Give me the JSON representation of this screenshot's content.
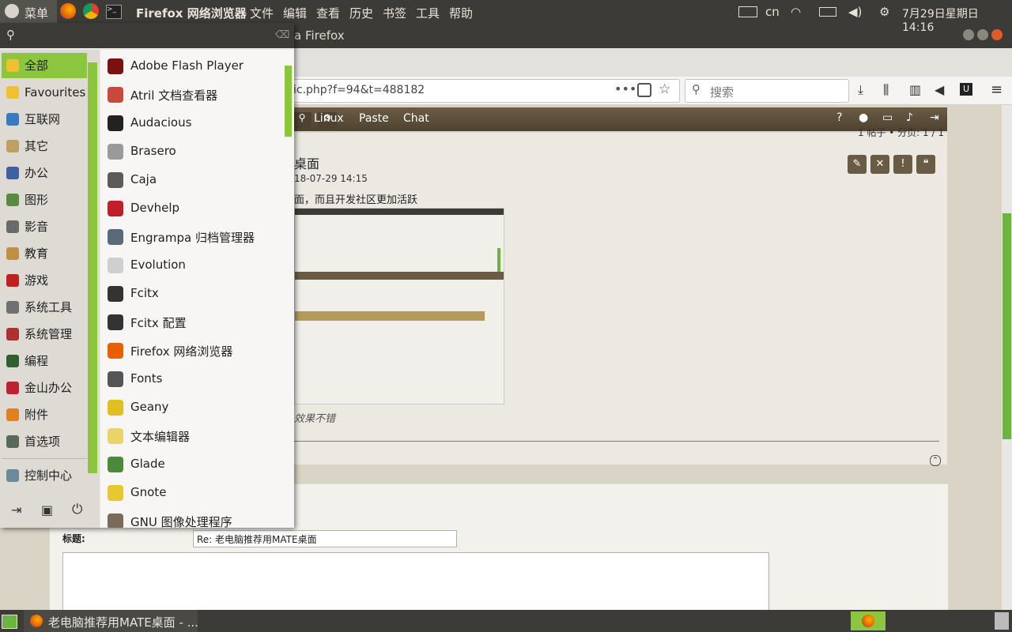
{
  "top_panel": {
    "menu_label": "菜单",
    "app_title": "Firefox 网络浏览器",
    "menus": [
      "文件",
      "编辑",
      "查看",
      "历史",
      "书签",
      "工具",
      "帮助"
    ],
    "ime": "cn",
    "datetime": "7月29日星期日 14:16"
  },
  "firefox": {
    "window_title": "a Firefox",
    "url": "ic.php?f=94&t=488182",
    "search_placeholder": "搜索",
    "nav_links": [
      "Linux",
      "Paste",
      "Chat"
    ],
    "post_title": "桌面",
    "post_date": "18-07-29 14:15",
    "post_text": "面，而且开发社区更加活跃",
    "post_caption": "效果不错",
    "page_counter": "1 帖子 • 分页: 1 / 1",
    "subject_label": "标题:",
    "subject_value": "Re: 老电脑推荐用MATE桌面"
  },
  "menu": {
    "search_value": "",
    "categories": [
      {
        "label": "全部",
        "icon": "star-icon"
      },
      {
        "label": "Favourites",
        "icon": "star-icon"
      },
      {
        "label": "互联网",
        "icon": "globe-icon"
      },
      {
        "label": "其它",
        "icon": "misc-icon"
      },
      {
        "label": "办公",
        "icon": "office-icon"
      },
      {
        "label": "图形",
        "icon": "graphics-icon"
      },
      {
        "label": "影音",
        "icon": "multimedia-icon"
      },
      {
        "label": "教育",
        "icon": "education-icon"
      },
      {
        "label": "游戏",
        "icon": "games-icon"
      },
      {
        "label": "系统工具",
        "icon": "gear-icon"
      },
      {
        "label": "系统管理",
        "icon": "admin-icon"
      },
      {
        "label": "编程",
        "icon": "programming-icon"
      },
      {
        "label": "金山办公",
        "icon": "wps-icon"
      },
      {
        "label": "附件",
        "icon": "accessories-icon"
      },
      {
        "label": "首选项",
        "icon": "preferences-icon"
      }
    ],
    "control_center": "控制中心",
    "apps": [
      {
        "label": "Adobe Flash Player",
        "color": "#7a1010"
      },
      {
        "label": "Atril 文档查看器",
        "color": "#c94a3a"
      },
      {
        "label": "Audacious",
        "color": "#222222"
      },
      {
        "label": "Brasero",
        "color": "#9a9a9a"
      },
      {
        "label": "Caja",
        "color": "#5a5a5a"
      },
      {
        "label": "Devhelp",
        "color": "#c0202a"
      },
      {
        "label": "Engrampa 归档管理器",
        "color": "#5a6a7a"
      },
      {
        "label": "Evolution",
        "color": "#cfcfcf"
      },
      {
        "label": "Fcitx",
        "color": "#333333"
      },
      {
        "label": "Fcitx 配置",
        "color": "#333333"
      },
      {
        "label": "Firefox 网络浏览器",
        "color": "#e66000"
      },
      {
        "label": "Fonts",
        "color": "#555555"
      },
      {
        "label": "Geany",
        "color": "#e0c020"
      },
      {
        "label": "文本编辑器",
        "color": "#e8d46a"
      },
      {
        "label": "Glade",
        "color": "#4a8a3a"
      },
      {
        "label": "Gnote",
        "color": "#e8c830"
      },
      {
        "label": "GNU 图像处理程序",
        "color": "#7a6a5a"
      }
    ]
  },
  "taskbar": {
    "window_label": "老电脑推荐用MATE桌面 - ..."
  },
  "colors": {
    "accent": "#8cc63f",
    "panel": "#3c3b37",
    "forum_nav": "#5c4f3a"
  }
}
